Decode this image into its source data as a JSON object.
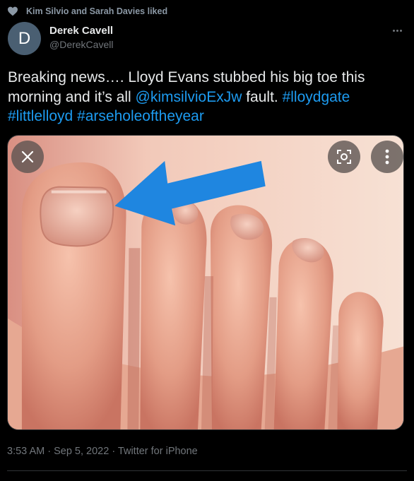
{
  "social_context": {
    "icon": "heart-icon",
    "text": "Kim Silvio and Sarah Davies liked"
  },
  "author": {
    "avatar_letter": "D",
    "avatar_color": "#4a5f72",
    "name": "Derek Cavell",
    "handle": "@DerekCavell"
  },
  "tweet": {
    "text_before": "Breaking news…. Lloyd Evans stubbed his big toe this morning and it’s all ",
    "mention": "@kimsilvioExJw",
    "text_middle": " fault.  ",
    "hashtag_1": "#lloydgate",
    "hashtag_2": "#littlelloyd",
    "hashtag_3": "#arseholeoftheyear"
  },
  "media": {
    "close_icon": "close-icon",
    "lens_icon": "lens-icon",
    "more_icon": "more-vertical-icon",
    "arrow_color": "#1f86e0"
  },
  "meta": {
    "timestamp": "3:53 AM · Sep 5, 2022 · Twitter for iPhone"
  },
  "colors": {
    "background": "#000000",
    "text": "#e7e9ea",
    "secondary": "#71767b",
    "link": "#1d9bf0"
  }
}
